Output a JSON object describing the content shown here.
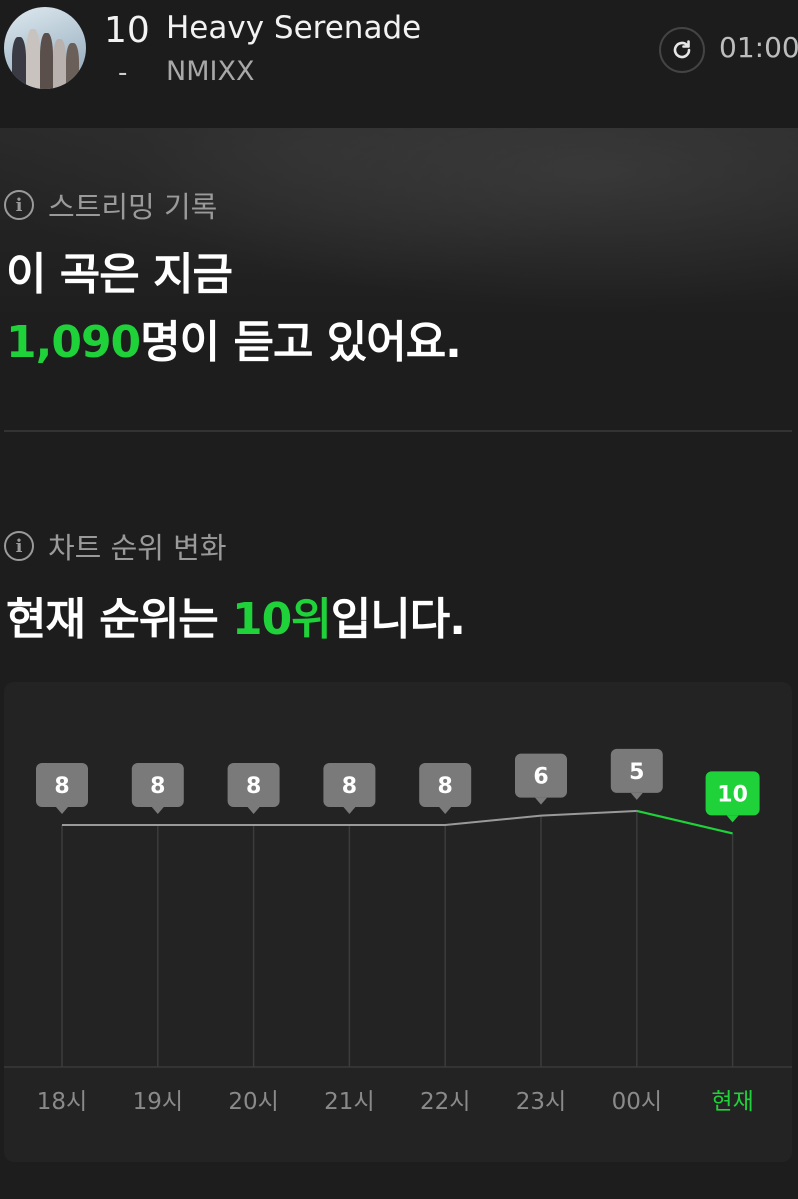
{
  "header": {
    "rank": "10",
    "rank_change": "-",
    "title": "Heavy Serenade",
    "artist": "NMIXX",
    "time": "01:00"
  },
  "streaming": {
    "label": "스트리밍 기록",
    "line1": "이 곡은 지금",
    "listeners": "1,090",
    "line2_suffix": "명이 듣고 있어요."
  },
  "chart_section": {
    "label": "차트 순위 변화",
    "headline_prefix": "현재 순위는 ",
    "current_rank": "10위",
    "headline_suffix": "입니다."
  },
  "colors": {
    "accent": "#1fd23a",
    "bubble": "#7a7a7a",
    "line": "#9a9a9a"
  },
  "chart_data": {
    "type": "line",
    "categories": [
      "18시",
      "19시",
      "20시",
      "21시",
      "22시",
      "23시",
      "00시",
      "현재"
    ],
    "values": [
      8,
      8,
      8,
      8,
      8,
      6,
      5,
      10
    ],
    "highlight_last": true
  }
}
